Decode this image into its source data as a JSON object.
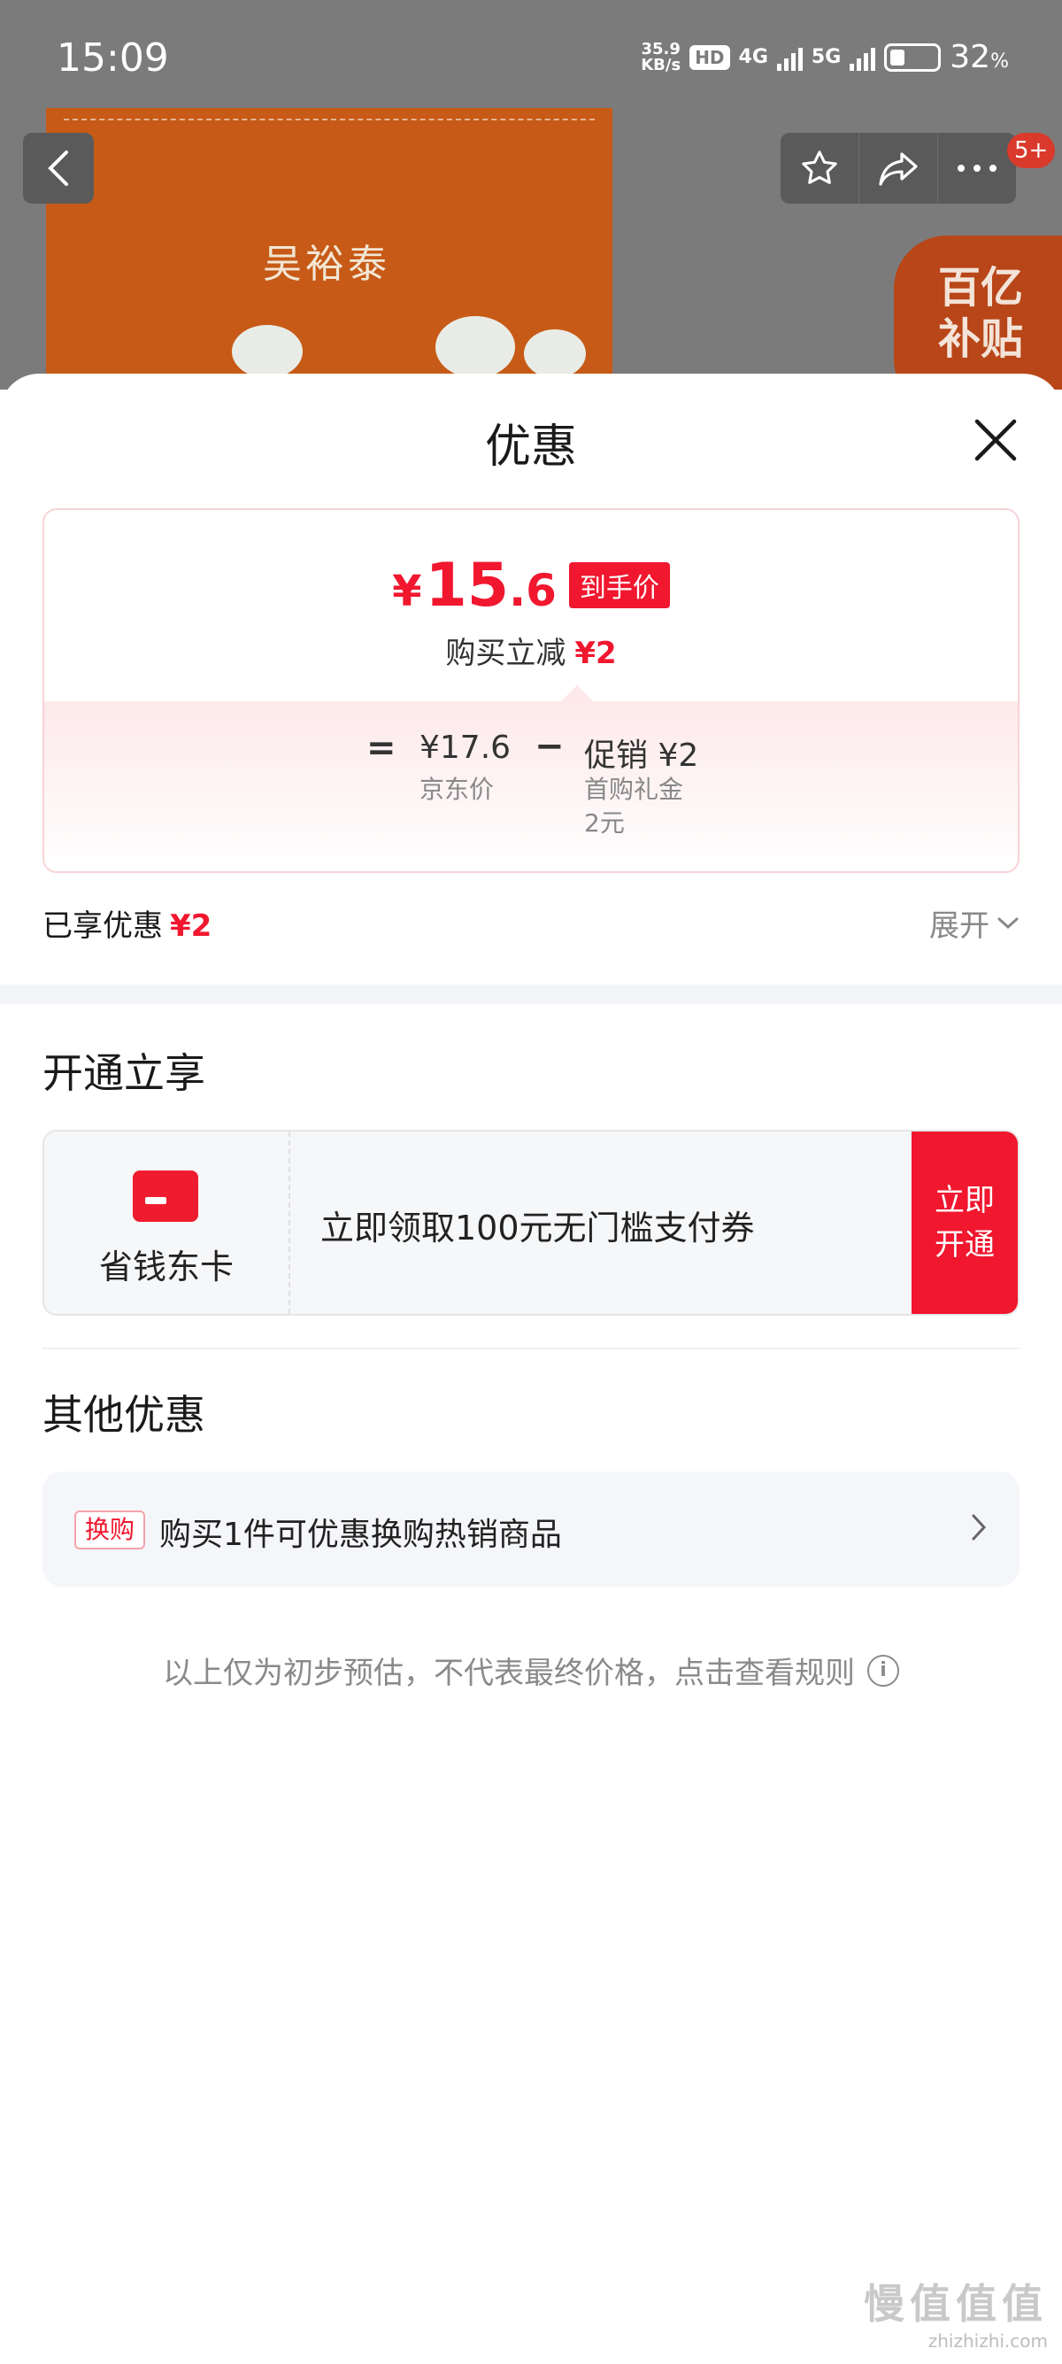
{
  "status_bar": {
    "time": "15:09",
    "net_speed": "35.9",
    "net_unit": "KB/s",
    "hd": "HD",
    "sig1": "4G",
    "sig2": "5G",
    "battery": "32",
    "battery_unit": "%"
  },
  "backdrop": {
    "brand_text": "吴裕泰",
    "cart_badge": "5+",
    "subsidy_line1": "百亿",
    "subsidy_line2": "补贴"
  },
  "sheet": {
    "title": "优惠",
    "price_card": {
      "currency": "¥",
      "final_int": "15",
      "final_dec": ".6",
      "final_tag": "到手价",
      "reduce_label": "购买立减",
      "reduce_amount": "¥2",
      "formula": {
        "eq": "=",
        "jd_price": "¥17.6",
        "jd_label": "京东价",
        "minus": "−",
        "promo_value": "促销 ¥2",
        "promo_sub1": "首购礼金",
        "promo_sub2": "2元"
      }
    },
    "enjoyed": {
      "label": "已享优惠",
      "amount": "¥2",
      "expand_label": "展开"
    },
    "open_section": {
      "title": "开通立享",
      "card_name": "省钱东卡",
      "card_desc": "立即领取100元无门槛支付券",
      "btn_line1": "立即",
      "btn_line2": "开通"
    },
    "other_section": {
      "title": "其他优惠",
      "swap_tag": "换购",
      "swap_text": "购买1件可优惠换购热销商品"
    },
    "disclaimer": "以上仅为初步预估，不代表最终价格，点击查看规则",
    "info_glyph": "i"
  },
  "watermark": {
    "main": "值值值",
    "prefix": "慢",
    "url": "zhizhizhi.com"
  },
  "colors": {
    "accent_red": "#f0172f",
    "card_border": "#f8d3d6",
    "backdrop": "#7b7b7b"
  }
}
